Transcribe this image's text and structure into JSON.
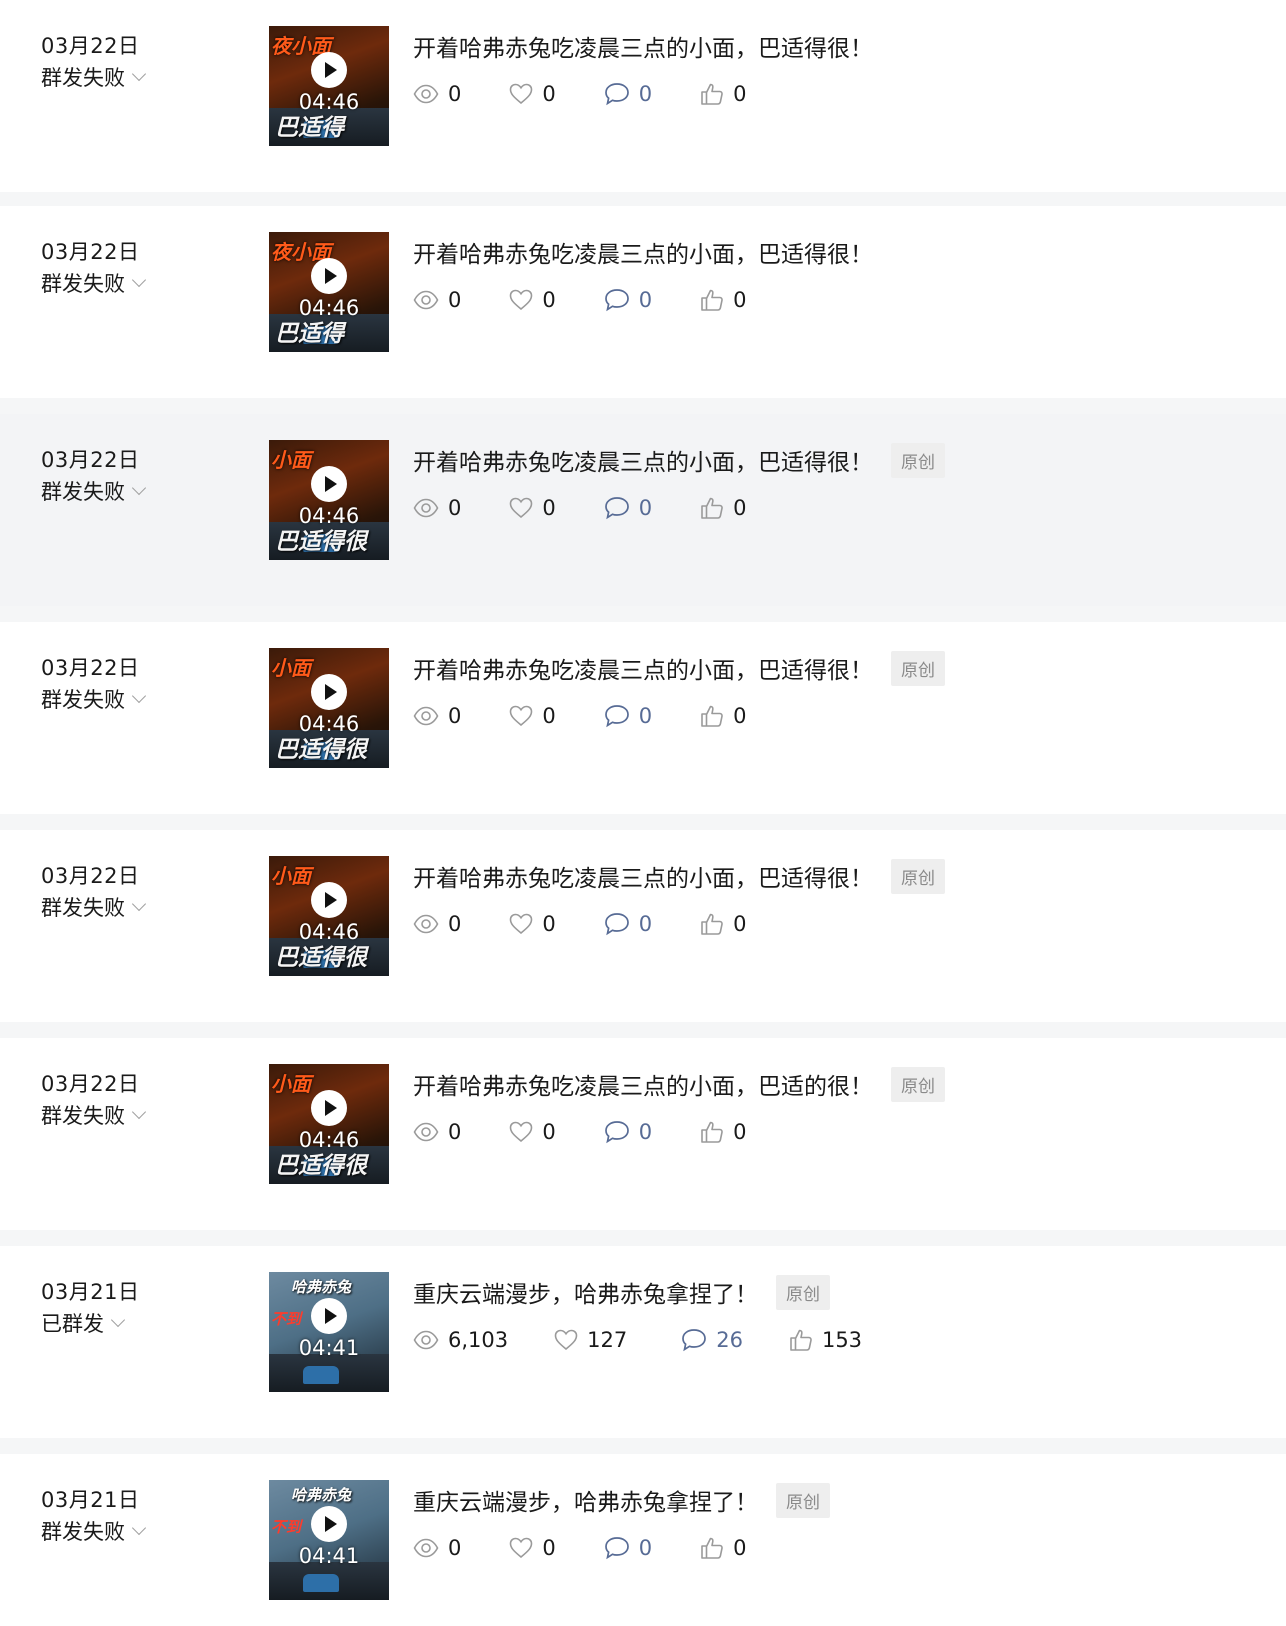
{
  "articles": [
    {
      "date": "03月22日",
      "status": "群发失败",
      "title": "开着哈弗赤兔吃凌晨三点的小面，巴适得很！",
      "badge": "",
      "duration": "04:46",
      "thumb_caption_top": "夜小面",
      "thumb_caption_bottom": "巴适得",
      "thumb_tone": "warm",
      "views": "0",
      "favorites": "0",
      "comments": "0",
      "likes": "0"
    },
    {
      "date": "03月22日",
      "status": "群发失败",
      "title": "开着哈弗赤兔吃凌晨三点的小面，巴适得很！",
      "badge": "",
      "duration": "04:46",
      "thumb_caption_top": "夜小面",
      "thumb_caption_bottom": "巴适得",
      "thumb_tone": "warm",
      "views": "0",
      "favorites": "0",
      "comments": "0",
      "likes": "0"
    },
    {
      "date": "03月22日",
      "status": "群发失败",
      "title": "开着哈弗赤兔吃凌晨三点的小面，巴适得很！",
      "badge": "原创",
      "duration": "04:46",
      "thumb_caption_top": "小面",
      "thumb_caption_bottom": "巴适得很",
      "thumb_tone": "warm",
      "views": "0",
      "favorites": "0",
      "comments": "0",
      "likes": "0"
    },
    {
      "date": "03月22日",
      "status": "群发失败",
      "title": "开着哈弗赤兔吃凌晨三点的小面，巴适得很！",
      "badge": "原创",
      "duration": "04:46",
      "thumb_caption_top": "小面",
      "thumb_caption_bottom": "巴适得很",
      "thumb_tone": "warm",
      "views": "0",
      "favorites": "0",
      "comments": "0",
      "likes": "0"
    },
    {
      "date": "03月22日",
      "status": "群发失败",
      "title": "开着哈弗赤兔吃凌晨三点的小面，巴适得很！",
      "badge": "原创",
      "duration": "04:46",
      "thumb_caption_top": "小面",
      "thumb_caption_bottom": "巴适得很",
      "thumb_tone": "warm",
      "views": "0",
      "favorites": "0",
      "comments": "0",
      "likes": "0"
    },
    {
      "date": "03月22日",
      "status": "群发失败",
      "title": "开着哈弗赤兔吃凌晨三点的小面，巴适的很！",
      "badge": "原创",
      "duration": "04:46",
      "thumb_caption_top": "小面",
      "thumb_caption_bottom": "巴适得很",
      "thumb_tone": "warm",
      "views": "0",
      "favorites": "0",
      "comments": "0",
      "likes": "0"
    },
    {
      "date": "03月21日",
      "status": "已群发",
      "title": "重庆云端漫步，哈弗赤兔拿捏了！",
      "badge": "原创",
      "duration": "04:41",
      "thumb_caption_top": "哈弗赤兔",
      "thumb_caption_bottom": "不到",
      "thumb_tone": "cool",
      "views": "6,103",
      "favorites": "127",
      "comments": "26",
      "likes": "153"
    },
    {
      "date": "03月21日",
      "status": "群发失败",
      "title": "重庆云端漫步，哈弗赤兔拿捏了！",
      "badge": "原创",
      "duration": "04:41",
      "thumb_caption_top": "哈弗赤兔",
      "thumb_caption_bottom": "不到",
      "thumb_tone": "cool",
      "views": "0",
      "favorites": "0",
      "comments": "0",
      "likes": "0"
    }
  ],
  "colors": {
    "page_background": "#f5f6f7",
    "row_background": "#ffffff",
    "row_highlight": "#f3f4f6",
    "comment_accent": "#576b95",
    "badge_background": "#eeeeee"
  },
  "icons": {
    "views": "eye-icon",
    "favorites": "heart-icon",
    "comments": "comment-icon",
    "likes": "thumbs-up-icon",
    "status": "chevron-down-icon",
    "play": "play-icon"
  }
}
